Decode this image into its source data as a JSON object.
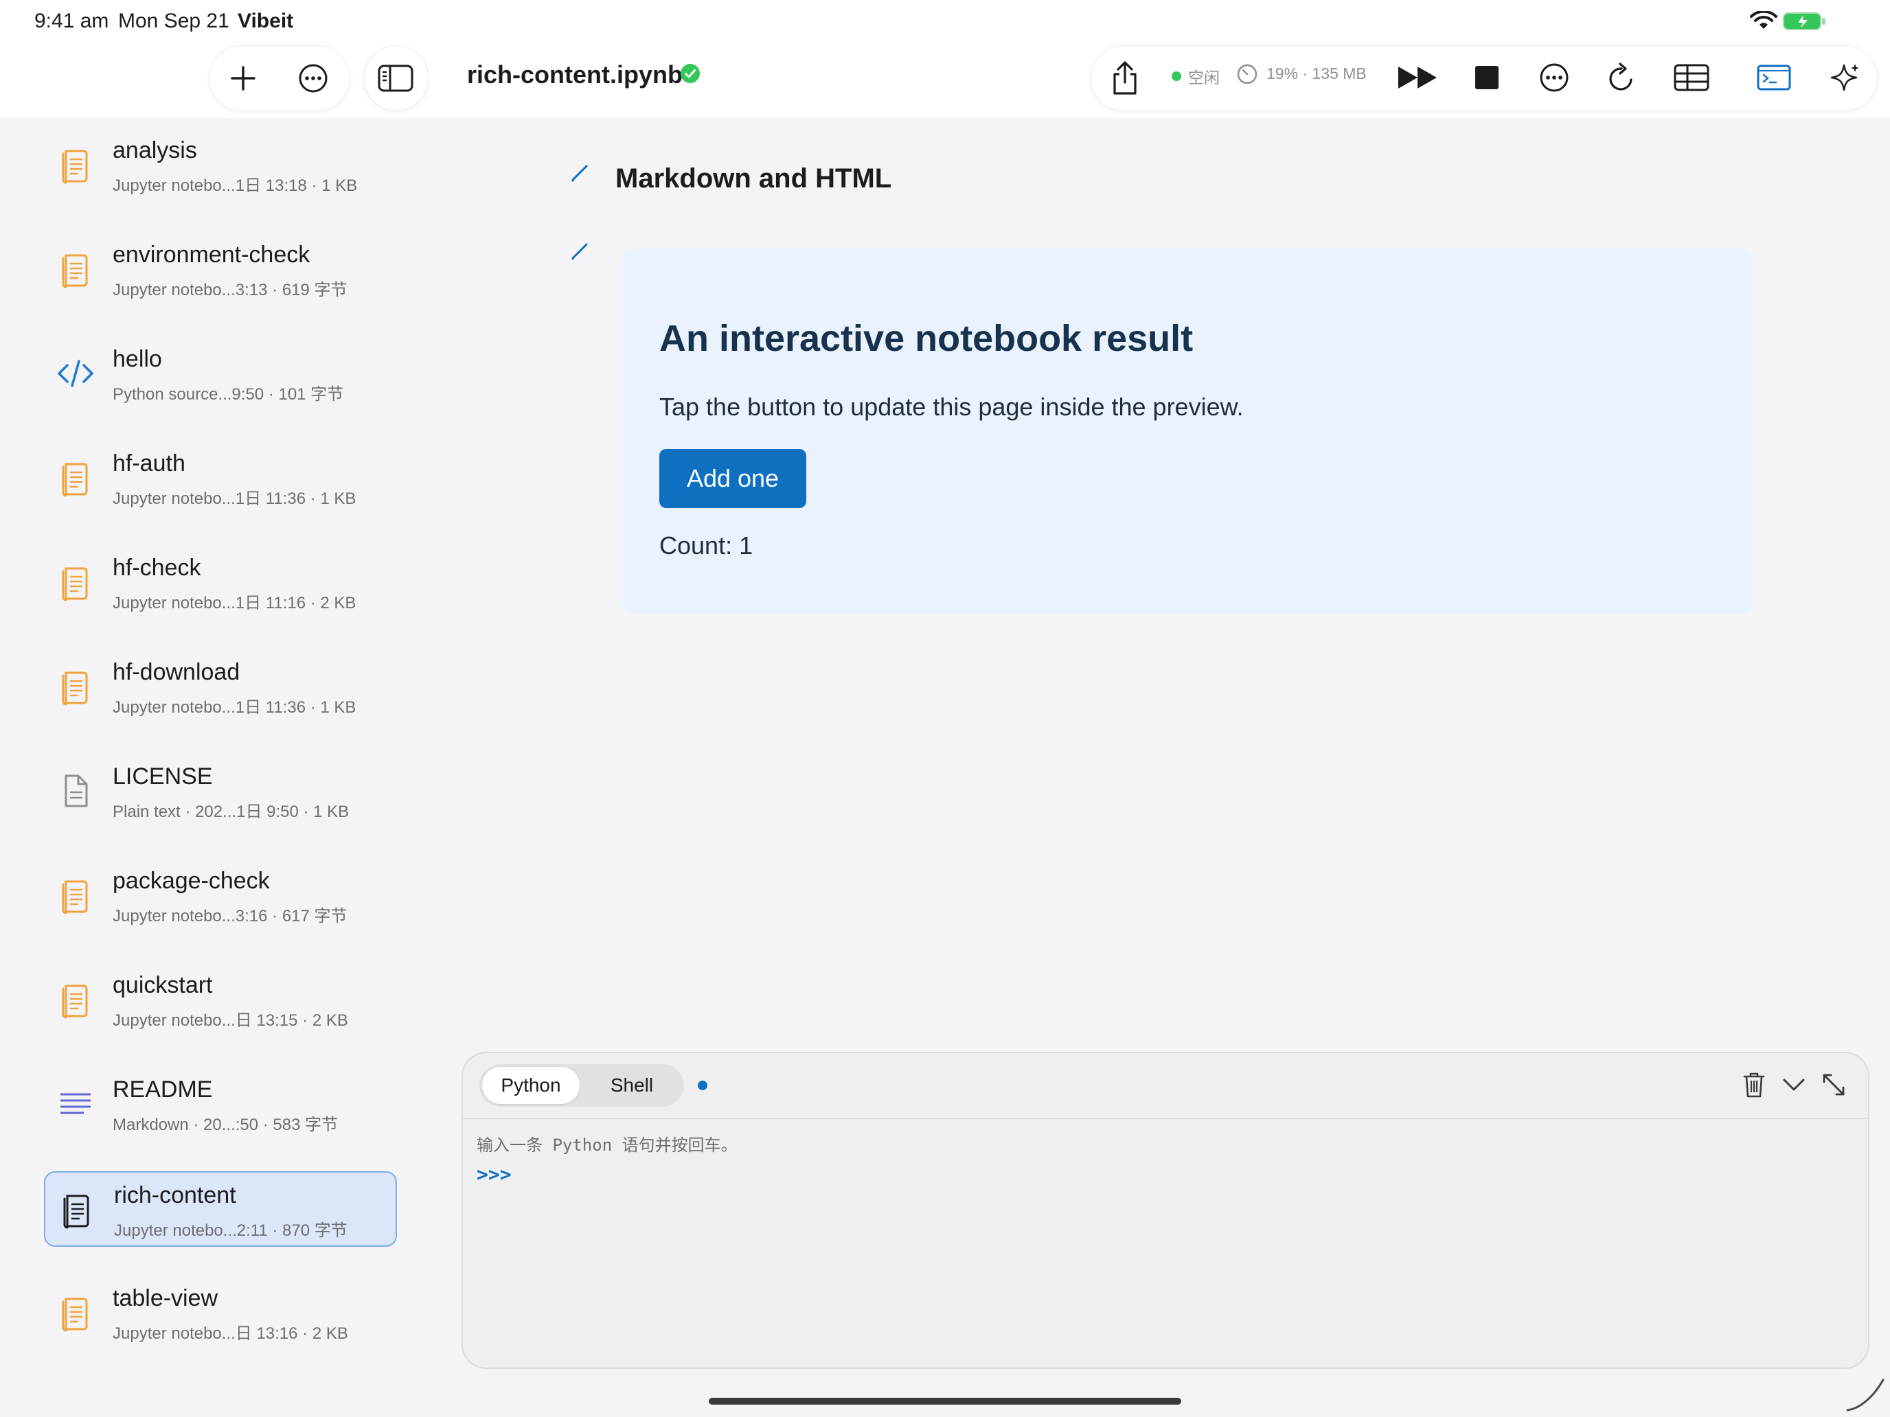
{
  "status_bar": {
    "time": "9:41 am",
    "date": "Mon Sep 21",
    "app": "Vibeit"
  },
  "toolbar": {
    "doc_title": "rich-content.ipynb",
    "kernel_state": "空闲",
    "cpu": "19%",
    "memory": "135 MB",
    "mem_sep": " · ",
    "icons": [
      "plus-icon",
      "ellipsis-circle-icon",
      "sidebar-icon",
      "share-icon",
      "gauge-icon",
      "run-all-icon",
      "stop-icon",
      "ellipsis-circle-icon",
      "restart-icon",
      "table-icon",
      "terminal-icon",
      "sparkles-icon"
    ]
  },
  "files": [
    {
      "name": "analysis",
      "meta": "Jupyter notebo...1日 13:18 · 1 KB",
      "icon": "notebook-icon",
      "selected": false
    },
    {
      "name": "environment-check",
      "meta": "Jupyter notebo...3:13 · 619 字节",
      "icon": "notebook-icon",
      "selected": false
    },
    {
      "name": "hello",
      "meta": "Python source...9:50 · 101 字节",
      "icon": "code-icon",
      "selected": false
    },
    {
      "name": "hf-auth",
      "meta": "Jupyter notebo...1日 11:36 · 1 KB",
      "icon": "notebook-icon",
      "selected": false
    },
    {
      "name": "hf-check",
      "meta": "Jupyter notebo...1日 11:16 · 2 KB",
      "icon": "notebook-icon",
      "selected": false
    },
    {
      "name": "hf-download",
      "meta": "Jupyter notebo...1日 11:36 · 1 KB",
      "icon": "notebook-icon",
      "selected": false
    },
    {
      "name": "LICENSE",
      "meta": "Plain text · 202...1日 9:50 · 1 KB",
      "icon": "text-document-icon",
      "selected": false
    },
    {
      "name": "package-check",
      "meta": "Jupyter notebo...3:16 · 617 字节",
      "icon": "notebook-icon",
      "selected": false
    },
    {
      "name": "quickstart",
      "meta": "Jupyter notebo...日 13:15 · 2 KB",
      "icon": "notebook-icon",
      "selected": false
    },
    {
      "name": "README",
      "meta": "Markdown · 20...:50 · 583 字节",
      "icon": "markdown-lines-icon",
      "selected": false
    },
    {
      "name": "rich-content",
      "meta": "Jupyter notebo...2:11 · 870 字节",
      "icon": "notebook-icon",
      "selected": true
    },
    {
      "name": "table-view",
      "meta": "Jupyter notebo...日 13:16 · 2 KB",
      "icon": "notebook-icon",
      "selected": false
    }
  ],
  "notebook": {
    "heading_cell": "Markdown and HTML",
    "html_output": {
      "title": "An interactive notebook result",
      "description": "Tap the button to update this page inside the preview.",
      "button_label": "Add one",
      "count_label": "Count: 1"
    }
  },
  "console": {
    "tabs": [
      "Python",
      "Shell"
    ],
    "active_tab": "Python",
    "hint": "输入一条 Python 语句并按回车。",
    "prompt": ">>>",
    "icons": [
      "trash-icon",
      "chevron-down-icon",
      "expand-icon"
    ]
  },
  "colors": {
    "accent": "#0f6fc1",
    "notebook_icon": "#f0a23c",
    "status_green": "#34c759",
    "selected_bg": "#dbe7f8"
  }
}
